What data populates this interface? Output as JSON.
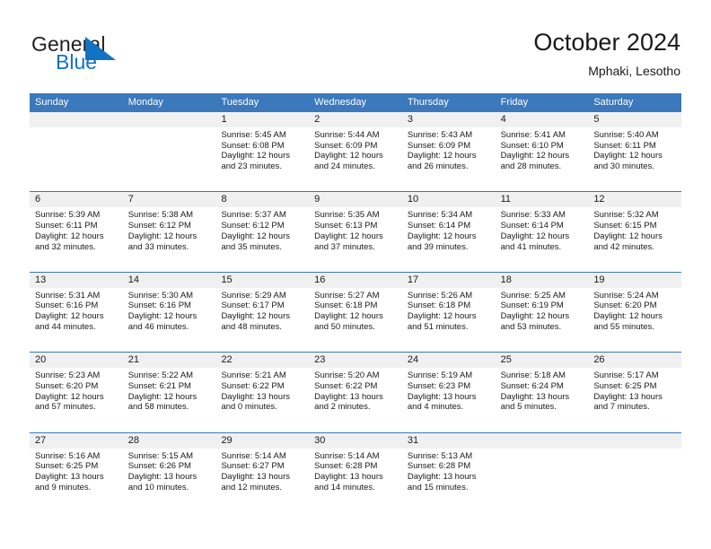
{
  "brand": {
    "name_part1": "General",
    "name_part2": "Blue",
    "triangle_color": "#1273c4"
  },
  "header": {
    "title": "October 2024",
    "subtitle": "Mphaki, Lesotho"
  },
  "colors": {
    "header_blue": "#3b78bc",
    "day_band_gray": "#f0f0f0",
    "text": "#1a1a1a",
    "brand_blue": "#1273c4"
  },
  "weekdays": [
    "Sunday",
    "Monday",
    "Tuesday",
    "Wednesday",
    "Thursday",
    "Friday",
    "Saturday"
  ],
  "weeks": [
    [
      {
        "day": "",
        "sunrise": "",
        "sunset": "",
        "daylight1": "",
        "daylight2": ""
      },
      {
        "day": "",
        "sunrise": "",
        "sunset": "",
        "daylight1": "",
        "daylight2": ""
      },
      {
        "day": "1",
        "sunrise": "Sunrise: 5:45 AM",
        "sunset": "Sunset: 6:08 PM",
        "daylight1": "Daylight: 12 hours",
        "daylight2": "and 23 minutes."
      },
      {
        "day": "2",
        "sunrise": "Sunrise: 5:44 AM",
        "sunset": "Sunset: 6:09 PM",
        "daylight1": "Daylight: 12 hours",
        "daylight2": "and 24 minutes."
      },
      {
        "day": "3",
        "sunrise": "Sunrise: 5:43 AM",
        "sunset": "Sunset: 6:09 PM",
        "daylight1": "Daylight: 12 hours",
        "daylight2": "and 26 minutes."
      },
      {
        "day": "4",
        "sunrise": "Sunrise: 5:41 AM",
        "sunset": "Sunset: 6:10 PM",
        "daylight1": "Daylight: 12 hours",
        "daylight2": "and 28 minutes."
      },
      {
        "day": "5",
        "sunrise": "Sunrise: 5:40 AM",
        "sunset": "Sunset: 6:11 PM",
        "daylight1": "Daylight: 12 hours",
        "daylight2": "and 30 minutes."
      }
    ],
    [
      {
        "day": "6",
        "sunrise": "Sunrise: 5:39 AM",
        "sunset": "Sunset: 6:11 PM",
        "daylight1": "Daylight: 12 hours",
        "daylight2": "and 32 minutes."
      },
      {
        "day": "7",
        "sunrise": "Sunrise: 5:38 AM",
        "sunset": "Sunset: 6:12 PM",
        "daylight1": "Daylight: 12 hours",
        "daylight2": "and 33 minutes."
      },
      {
        "day": "8",
        "sunrise": "Sunrise: 5:37 AM",
        "sunset": "Sunset: 6:12 PM",
        "daylight1": "Daylight: 12 hours",
        "daylight2": "and 35 minutes."
      },
      {
        "day": "9",
        "sunrise": "Sunrise: 5:35 AM",
        "sunset": "Sunset: 6:13 PM",
        "daylight1": "Daylight: 12 hours",
        "daylight2": "and 37 minutes."
      },
      {
        "day": "10",
        "sunrise": "Sunrise: 5:34 AM",
        "sunset": "Sunset: 6:14 PM",
        "daylight1": "Daylight: 12 hours",
        "daylight2": "and 39 minutes."
      },
      {
        "day": "11",
        "sunrise": "Sunrise: 5:33 AM",
        "sunset": "Sunset: 6:14 PM",
        "daylight1": "Daylight: 12 hours",
        "daylight2": "and 41 minutes."
      },
      {
        "day": "12",
        "sunrise": "Sunrise: 5:32 AM",
        "sunset": "Sunset: 6:15 PM",
        "daylight1": "Daylight: 12 hours",
        "daylight2": "and 42 minutes."
      }
    ],
    [
      {
        "day": "13",
        "sunrise": "Sunrise: 5:31 AM",
        "sunset": "Sunset: 6:16 PM",
        "daylight1": "Daylight: 12 hours",
        "daylight2": "and 44 minutes."
      },
      {
        "day": "14",
        "sunrise": "Sunrise: 5:30 AM",
        "sunset": "Sunset: 6:16 PM",
        "daylight1": "Daylight: 12 hours",
        "daylight2": "and 46 minutes."
      },
      {
        "day": "15",
        "sunrise": "Sunrise: 5:29 AM",
        "sunset": "Sunset: 6:17 PM",
        "daylight1": "Daylight: 12 hours",
        "daylight2": "and 48 minutes."
      },
      {
        "day": "16",
        "sunrise": "Sunrise: 5:27 AM",
        "sunset": "Sunset: 6:18 PM",
        "daylight1": "Daylight: 12 hours",
        "daylight2": "and 50 minutes."
      },
      {
        "day": "17",
        "sunrise": "Sunrise: 5:26 AM",
        "sunset": "Sunset: 6:18 PM",
        "daylight1": "Daylight: 12 hours",
        "daylight2": "and 51 minutes."
      },
      {
        "day": "18",
        "sunrise": "Sunrise: 5:25 AM",
        "sunset": "Sunset: 6:19 PM",
        "daylight1": "Daylight: 12 hours",
        "daylight2": "and 53 minutes."
      },
      {
        "day": "19",
        "sunrise": "Sunrise: 5:24 AM",
        "sunset": "Sunset: 6:20 PM",
        "daylight1": "Daylight: 12 hours",
        "daylight2": "and 55 minutes."
      }
    ],
    [
      {
        "day": "20",
        "sunrise": "Sunrise: 5:23 AM",
        "sunset": "Sunset: 6:20 PM",
        "daylight1": "Daylight: 12 hours",
        "daylight2": "and 57 minutes."
      },
      {
        "day": "21",
        "sunrise": "Sunrise: 5:22 AM",
        "sunset": "Sunset: 6:21 PM",
        "daylight1": "Daylight: 12 hours",
        "daylight2": "and 58 minutes."
      },
      {
        "day": "22",
        "sunrise": "Sunrise: 5:21 AM",
        "sunset": "Sunset: 6:22 PM",
        "daylight1": "Daylight: 13 hours",
        "daylight2": "and 0 minutes."
      },
      {
        "day": "23",
        "sunrise": "Sunrise: 5:20 AM",
        "sunset": "Sunset: 6:22 PM",
        "daylight1": "Daylight: 13 hours",
        "daylight2": "and 2 minutes."
      },
      {
        "day": "24",
        "sunrise": "Sunrise: 5:19 AM",
        "sunset": "Sunset: 6:23 PM",
        "daylight1": "Daylight: 13 hours",
        "daylight2": "and 4 minutes."
      },
      {
        "day": "25",
        "sunrise": "Sunrise: 5:18 AM",
        "sunset": "Sunset: 6:24 PM",
        "daylight1": "Daylight: 13 hours",
        "daylight2": "and 5 minutes."
      },
      {
        "day": "26",
        "sunrise": "Sunrise: 5:17 AM",
        "sunset": "Sunset: 6:25 PM",
        "daylight1": "Daylight: 13 hours",
        "daylight2": "and 7 minutes."
      }
    ],
    [
      {
        "day": "27",
        "sunrise": "Sunrise: 5:16 AM",
        "sunset": "Sunset: 6:25 PM",
        "daylight1": "Daylight: 13 hours",
        "daylight2": "and 9 minutes."
      },
      {
        "day": "28",
        "sunrise": "Sunrise: 5:15 AM",
        "sunset": "Sunset: 6:26 PM",
        "daylight1": "Daylight: 13 hours",
        "daylight2": "and 10 minutes."
      },
      {
        "day": "29",
        "sunrise": "Sunrise: 5:14 AM",
        "sunset": "Sunset: 6:27 PM",
        "daylight1": "Daylight: 13 hours",
        "daylight2": "and 12 minutes."
      },
      {
        "day": "30",
        "sunrise": "Sunrise: 5:14 AM",
        "sunset": "Sunset: 6:28 PM",
        "daylight1": "Daylight: 13 hours",
        "daylight2": "and 14 minutes."
      },
      {
        "day": "31",
        "sunrise": "Sunrise: 5:13 AM",
        "sunset": "Sunset: 6:28 PM",
        "daylight1": "Daylight: 13 hours",
        "daylight2": "and 15 minutes."
      },
      {
        "day": "",
        "sunrise": "",
        "sunset": "",
        "daylight1": "",
        "daylight2": ""
      },
      {
        "day": "",
        "sunrise": "",
        "sunset": "",
        "daylight1": "",
        "daylight2": ""
      }
    ]
  ]
}
